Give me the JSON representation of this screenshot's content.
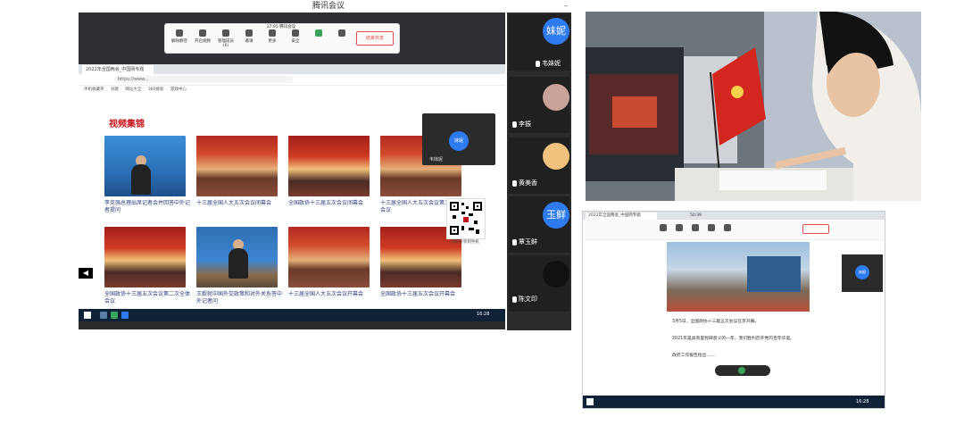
{
  "meeting": {
    "title": "腾讯会议",
    "time": "37:05",
    "app_name": "腾讯会议",
    "end_share": "结束共享",
    "toolbar": [
      "解除静音",
      "开启视频",
      "管理成员(6)",
      "邀请",
      "更多",
      "安全",
      "结束共享"
    ]
  },
  "browser": {
    "tab_title": "2022年全国两会_中国网专题",
    "address": "https://www...",
    "bookmarks": [
      "手机收藏夹",
      "谷歌",
      "网址大全",
      "360搜索",
      "游戏中心"
    ]
  },
  "page": {
    "heading": "视频集锦",
    "videos": [
      {
        "caption": "李克强总理出席记者会并回答中外记者提问",
        "thumb": "blue"
      },
      {
        "caption": "十三届全国人大五次会议闭幕会",
        "thumb": "hall"
      },
      {
        "caption": "全国政协十三届五次会议闭幕会",
        "thumb": "hall2"
      },
      {
        "caption": "十三届全国人大五次会议第二次全体会议",
        "thumb": "hall"
      },
      {
        "caption": "全国政协十三届五次会议第二次全体会议",
        "thumb": "hall2"
      },
      {
        "caption": "王毅就中国外交政策和对外关系答中外记者问",
        "thumb": "press"
      },
      {
        "caption": "十三届全国人大五次会议开幕会",
        "thumb": "hall"
      },
      {
        "caption": "全国政协十三届五次会议开幕会",
        "thumb": "hall2"
      }
    ],
    "floating_name": "妹妮",
    "floating_label": "韦妹妮",
    "qr_label": "扫码分享到手机",
    "taskbar_time": "16:28"
  },
  "participants": [
    {
      "name": "韦妹妮",
      "avatar": "妹妮",
      "color": "#2e7bf0"
    },
    {
      "name": "李振",
      "avatar": "",
      "color": "#c99"
    },
    {
      "name": "黄美香",
      "avatar": "",
      "color": "#f1c27d"
    },
    {
      "name": "覃玉鲜",
      "avatar": "玉鲜",
      "color": "#2e7bf0"
    },
    {
      "name": "陈文印",
      "avatar": "",
      "color": "#111"
    }
  ],
  "screen2": {
    "title": "2022年全国两会_中国网专题",
    "time": "50:39",
    "article": [
      "3月5日，全国政协十三届五次会议在京开幕。",
      "2021年是具有里程碑意义的一年，我们胜利召开党的百年华诞。",
      "政府工作报告指出……"
    ],
    "floating_name": "妹妮",
    "taskbar_time": "16:28"
  }
}
